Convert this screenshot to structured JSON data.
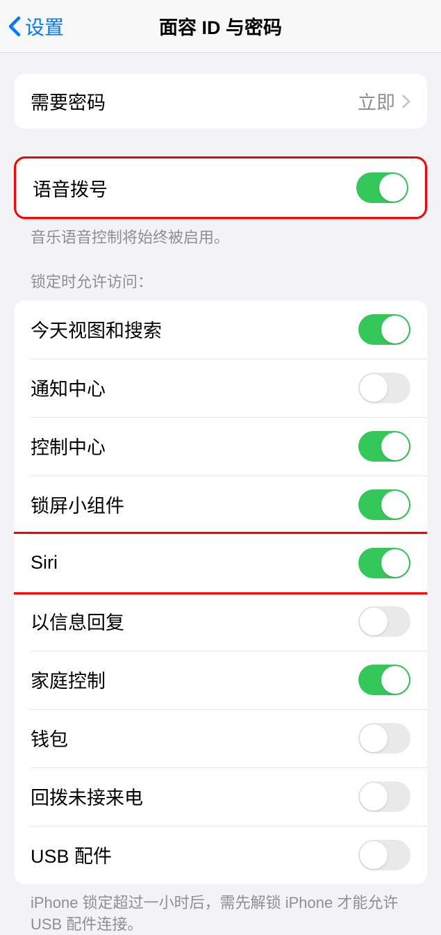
{
  "nav": {
    "back_label": "设置",
    "title": "面容 ID 与密码"
  },
  "require_passcode": {
    "label": "需要密码",
    "value": "立即"
  },
  "voice_dial": {
    "label": "语音拨号",
    "on": true
  },
  "voice_dial_footer": "音乐语音控制将始终被启用。",
  "lock_access_header": "锁定时允许访问：",
  "lock_items": [
    {
      "label": "今天视图和搜索",
      "on": true
    },
    {
      "label": "通知中心",
      "on": false
    },
    {
      "label": "控制中心",
      "on": true
    },
    {
      "label": "锁屏小组件",
      "on": true
    },
    {
      "label": "Siri",
      "on": true,
      "highlight": true
    },
    {
      "label": "以信息回复",
      "on": false
    },
    {
      "label": "家庭控制",
      "on": true
    },
    {
      "label": "钱包",
      "on": false
    },
    {
      "label": "回拨未接来电",
      "on": false
    },
    {
      "label": "USB 配件",
      "on": false
    }
  ],
  "usb_footer": "iPhone 锁定超过一小时后，需先解锁 iPhone 才能允许 USB 配件连接。"
}
